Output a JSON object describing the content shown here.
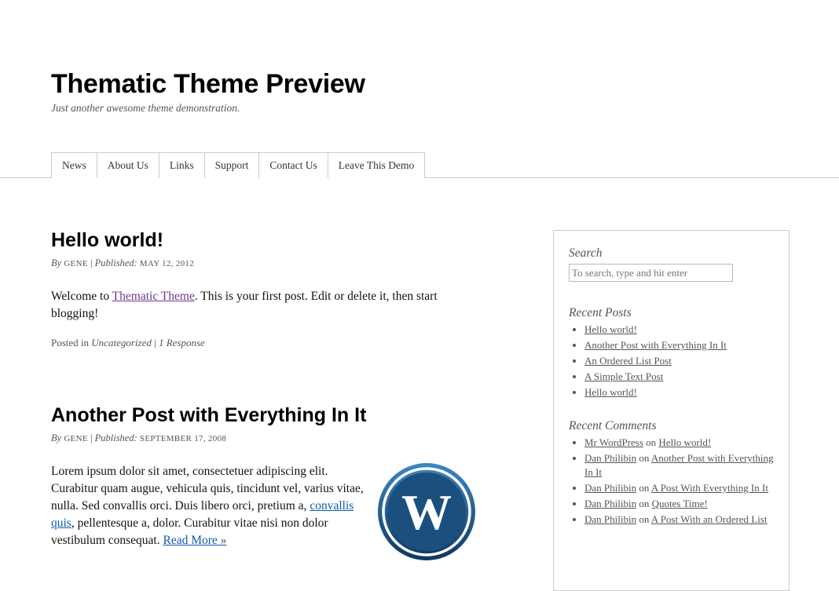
{
  "header": {
    "title": "Thematic Theme Preview",
    "description": "Just another awesome theme demonstration."
  },
  "nav": {
    "items": [
      {
        "label": "News"
      },
      {
        "label": "About Us"
      },
      {
        "label": "Links"
      },
      {
        "label": "Support"
      },
      {
        "label": "Contact Us"
      },
      {
        "label": "Leave This Demo"
      }
    ]
  },
  "posts": [
    {
      "title": "Hello world!",
      "by_label": "By",
      "author": "GENE",
      "published_label": "Published:",
      "date": "MAY 12, 2012",
      "content_pre": "Welcome to ",
      "content_link": "Thematic Theme",
      "content_post": ". This is your first post. Edit or delete it, then start blogging!",
      "posted_in_label": "Posted in",
      "category": "Uncategorized",
      "responses": "1 Response"
    },
    {
      "title": "Another Post with Everything In It",
      "by_label": "By",
      "author": "GENE",
      "published_label": "Published:",
      "date": "SEPTEMBER 17, 2008",
      "content_pre": "Lorem ipsum dolor sit amet, consectetuer adipiscing elit. Curabitur quam augue, vehicula quis, tincidunt vel, varius vitae, nulla. Sed convallis orci. Duis libero orci, pretium a, ",
      "content_link": "convallis quis",
      "content_post": ", pellentesque a, dolor. Curabitur vitae nisi non dolor vestibulum consequat. ",
      "read_more": "Read More »"
    }
  ],
  "sidebar": {
    "search": {
      "title": "Search",
      "placeholder": "To search, type and hit enter"
    },
    "recent_posts": {
      "title": "Recent Posts",
      "items": [
        "Hello world!",
        "Another Post with Everything In It",
        "An Ordered List Post",
        "A Simple Text Post",
        "Hello world!"
      ]
    },
    "recent_comments": {
      "title": "Recent Comments",
      "on_label": "on",
      "items": [
        {
          "author": "Mr WordPress",
          "post": "Hello world!"
        },
        {
          "author": "Dan Philibin",
          "post": "Another Post with Everything In It"
        },
        {
          "author": "Dan Philibin",
          "post": "A Post With Everything In It"
        },
        {
          "author": "Dan Philibin",
          "post": "Quotes Time!"
        },
        {
          "author": "Dan Philibin",
          "post": "A Post With an Ordered List"
        }
      ]
    }
  },
  "colors": {
    "link_visited": "#6b3a8e",
    "link": "#0e5aa8",
    "logo_blue": "#1e5b8c",
    "border": "#cccccc"
  },
  "icons": {
    "post_image": "wordpress-logo-icon"
  }
}
